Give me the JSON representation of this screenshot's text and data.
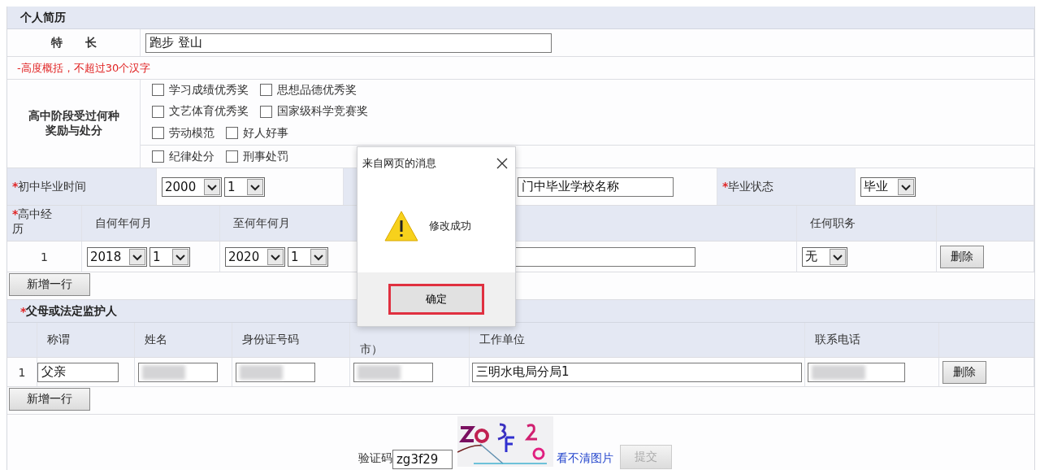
{
  "resume": {
    "title": "个人简历",
    "specialty": {
      "label": "特　　长",
      "value": "跑步 登山"
    },
    "hint": "-高度概括，不超过30个汉字",
    "awards": {
      "label": "高中阶段受过何种奖励与处分",
      "rewards": [
        [
          {
            "label": "学习成绩优秀奖",
            "checked": false
          },
          {
            "label": "思想品德优秀奖",
            "checked": false
          }
        ],
        [
          {
            "label": "文艺体育优秀奖",
            "checked": false
          },
          {
            "label": "国家级科学竞赛奖",
            "checked": false
          }
        ],
        [
          {
            "label": "劳动模范",
            "checked": false
          },
          {
            "label": "好人好事",
            "checked": false
          }
        ]
      ],
      "penalties": [
        {
          "label": "纪律处分",
          "checked": false
        },
        {
          "label": "刑事处罚",
          "checked": false
        }
      ]
    }
  },
  "junior": {
    "required_mark": "*",
    "label": "初中毕业时间",
    "year": "2000",
    "month": "1",
    "school": "门中毕业学校名称",
    "status_label": "毕业状态",
    "status": "毕业"
  },
  "high_school": {
    "required_mark": "*",
    "label": "高中经历",
    "columns": [
      "自何年何月",
      "至何年何月",
      "任何职务"
    ],
    "rows": [
      {
        "index": "1",
        "from_year": "2018",
        "from_month": "1",
        "to_year": "2020",
        "to_month": "1",
        "position": "无",
        "delete": "删除"
      }
    ],
    "add_button": "新增一行"
  },
  "guardians": {
    "required_mark": "*",
    "title": "父母或法定监护人",
    "columns": [
      "称谓",
      "姓名",
      "身份证号码",
      "市）",
      "工作单位",
      "联系电话"
    ],
    "rows": [
      {
        "index": "1",
        "relation": "父亲",
        "name_blurred": true,
        "id_blurred": true,
        "region_blurred": true,
        "employer": "三明水电局分局1",
        "phone_blurred": true,
        "delete": "删除"
      }
    ],
    "add_button": "新增一行"
  },
  "captcha": {
    "label": "验证码",
    "value": "zg3f29",
    "refresh_link": "看不清图片",
    "submit": "提交",
    "submit_disabled": true
  },
  "dialog": {
    "title": "来自网页的消息",
    "message": "修改成功",
    "ok": "确定",
    "ok_focused": true
  }
}
